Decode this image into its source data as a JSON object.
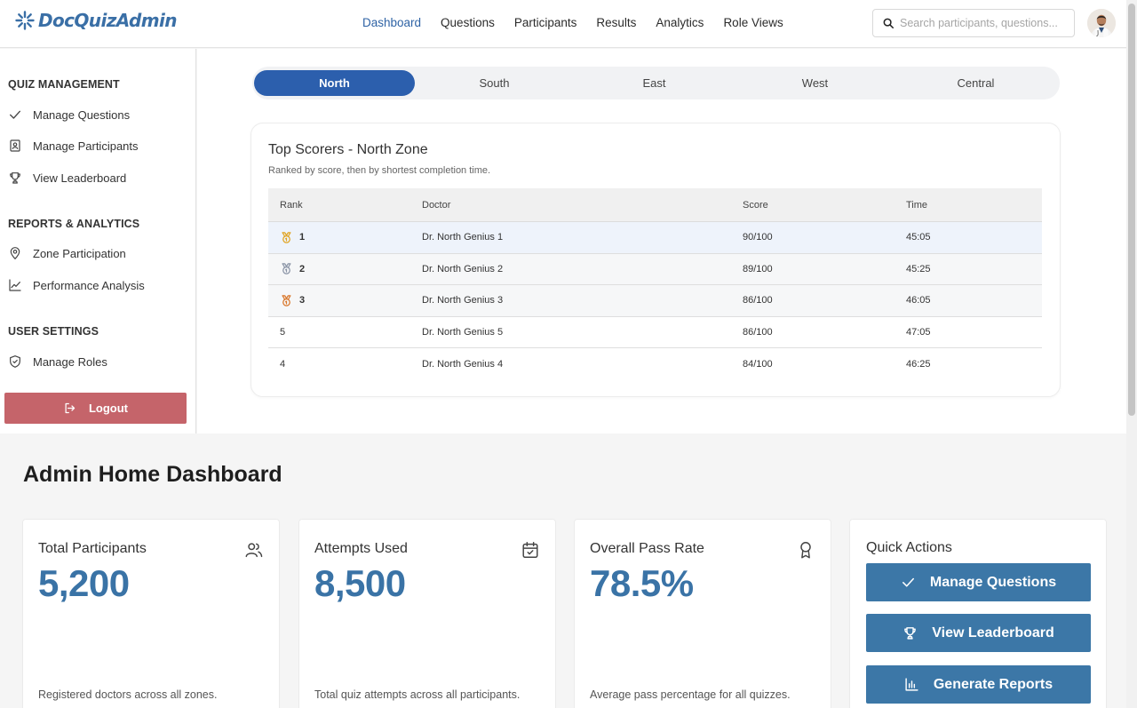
{
  "header": {
    "logo_text": "DocQuizAdmin",
    "nav": [
      {
        "label": "Dashboard",
        "active": true
      },
      {
        "label": "Questions"
      },
      {
        "label": "Participants"
      },
      {
        "label": "Results"
      },
      {
        "label": "Analytics"
      },
      {
        "label": "Role Views"
      }
    ],
    "search_placeholder": "Search participants, questions..."
  },
  "sidebar": {
    "sections": [
      {
        "title": "QUIZ MANAGEMENT",
        "items": [
          {
            "label": "Manage Questions",
            "icon": "check-icon"
          },
          {
            "label": "Manage Participants",
            "icon": "id-badge-icon"
          },
          {
            "label": "View Leaderboard",
            "icon": "trophy-icon"
          }
        ]
      },
      {
        "title": "REPORTS & ANALYTICS",
        "items": [
          {
            "label": "Zone Participation",
            "icon": "map-pin-icon"
          },
          {
            "label": "Performance Analysis",
            "icon": "line-chart-icon"
          }
        ]
      },
      {
        "title": "USER SETTINGS",
        "items": [
          {
            "label": "Manage Roles",
            "icon": "shield-icon"
          }
        ]
      }
    ],
    "logout_label": "Logout"
  },
  "zones": {
    "tabs": [
      "North",
      "South",
      "East",
      "West",
      "Central"
    ],
    "active": "North"
  },
  "top_scorers": {
    "title": "Top Scorers - North Zone",
    "subtitle": "Ranked by score, then by shortest completion time.",
    "columns": [
      "Rank",
      "Doctor",
      "Score",
      "Time"
    ],
    "rows": [
      {
        "rank": "1",
        "medal": "gold",
        "doctor": "Dr. North Genius 1",
        "score": "90/100",
        "time": "45:05"
      },
      {
        "rank": "2",
        "medal": "silver",
        "doctor": "Dr. North Genius 2",
        "score": "89/100",
        "time": "45:25"
      },
      {
        "rank": "3",
        "medal": "bronze",
        "doctor": "Dr. North Genius 3",
        "score": "86/100",
        "time": "46:05"
      },
      {
        "rank": "5",
        "medal": "",
        "doctor": "Dr. North Genius 5",
        "score": "86/100",
        "time": "47:05"
      },
      {
        "rank": "4",
        "medal": "",
        "doctor": "Dr. North Genius 4",
        "score": "84/100",
        "time": "46:25"
      }
    ]
  },
  "dashboard": {
    "title": "Admin Home Dashboard",
    "stats": [
      {
        "label": "Total Participants",
        "value": "5,200",
        "desc": "Registered doctors across all zones.",
        "icon": "users-icon"
      },
      {
        "label": "Attempts Used",
        "value": "8,500",
        "desc": "Total quiz attempts across all participants.",
        "icon": "calendar-check-icon"
      },
      {
        "label": "Overall Pass Rate",
        "value": "78.5%",
        "desc": "Average pass percentage for all quizzes.",
        "icon": "award-icon"
      }
    ],
    "quick_actions": {
      "title": "Quick Actions",
      "buttons": [
        {
          "label": "Manage Questions",
          "icon": "check-icon"
        },
        {
          "label": "View Leaderboard",
          "icon": "trophy-icon"
        },
        {
          "label": "Generate Reports",
          "icon": "bar-chart-icon"
        }
      ]
    }
  },
  "colors": {
    "brand": "#3a6fa6",
    "active_tab": "#2c5fad",
    "logout": "#c5646a",
    "action_button": "#3c77a7",
    "medal_gold": "#e0a422",
    "medal_silver": "#8a94a6",
    "medal_bronze": "#d9772b"
  }
}
